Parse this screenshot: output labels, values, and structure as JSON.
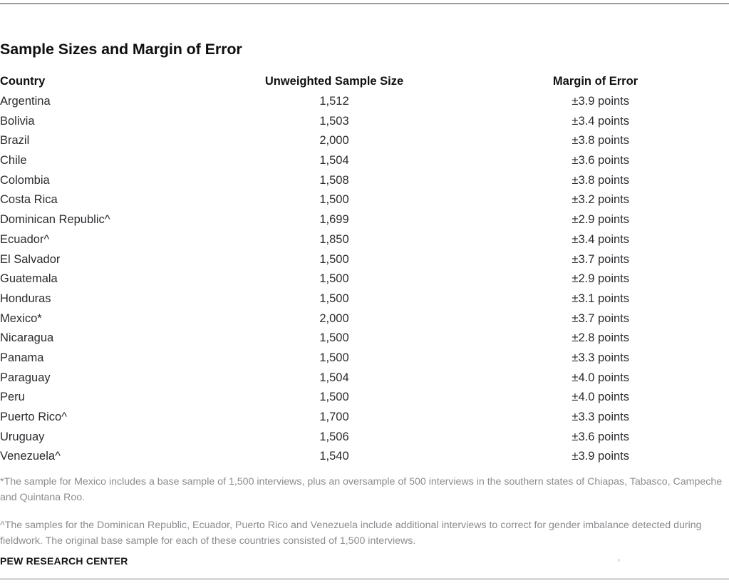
{
  "title": "Sample Sizes and Margin of Error",
  "columns": {
    "country": "Country",
    "sample_size": "Unweighted Sample Size",
    "margin_of_error": "Margin of Error"
  },
  "rows": [
    {
      "country": "Argentina",
      "sample_size": "1,512",
      "margin_of_error": "±3.9 points"
    },
    {
      "country": "Bolivia",
      "sample_size": "1,503",
      "margin_of_error": "±3.4 points"
    },
    {
      "country": "Brazil",
      "sample_size": "2,000",
      "margin_of_error": "±3.8 points"
    },
    {
      "country": "Chile",
      "sample_size": "1,504",
      "margin_of_error": "±3.6 points"
    },
    {
      "country": "Colombia",
      "sample_size": "1,508",
      "margin_of_error": "±3.8 points"
    },
    {
      "country": "Costa Rica",
      "sample_size": "1,500",
      "margin_of_error": "±3.2 points"
    },
    {
      "country": "Dominican Republic^",
      "sample_size": "1,699",
      "margin_of_error": "±2.9 points"
    },
    {
      "country": "Ecuador^",
      "sample_size": "1,850",
      "margin_of_error": "±3.4 points"
    },
    {
      "country": "El Salvador",
      "sample_size": "1,500",
      "margin_of_error": "±3.7 points"
    },
    {
      "country": "Guatemala",
      "sample_size": "1,500",
      "margin_of_error": "±2.9 points"
    },
    {
      "country": "Honduras",
      "sample_size": "1,500",
      "margin_of_error": "±3.1 points"
    },
    {
      "country": "Mexico*",
      "sample_size": "2,000",
      "margin_of_error": "±3.7 points"
    },
    {
      "country": "Nicaragua",
      "sample_size": "1,500",
      "margin_of_error": "±2.8 points"
    },
    {
      "country": "Panama",
      "sample_size": "1,500",
      "margin_of_error": "±3.3 points"
    },
    {
      "country": "Paraguay",
      "sample_size": "1,504",
      "margin_of_error": "±4.0 points"
    },
    {
      "country": "Peru",
      "sample_size": "1,500",
      "margin_of_error": "±4.0 points"
    },
    {
      "country": "Puerto Rico^",
      "sample_size": "1,700",
      "margin_of_error": "±3.3 points"
    },
    {
      "country": "Uruguay",
      "sample_size": "1,506",
      "margin_of_error": "±3.6 points"
    },
    {
      "country": "Venezuela^",
      "sample_size": "1,540",
      "margin_of_error": "±3.9 points"
    }
  ],
  "footnotes": [
    "*The sample for Mexico includes a base sample of 1,500 interviews, plus an oversample of 500 interviews in the southern states of Chiapas, Tabasco, Campeche and Quintana Roo.",
    "^The samples for the Dominican Republic, Ecuador, Puerto Rico and Venezuela include additional interviews to correct for gender imbalance detected during fieldwork. The original base sample for each of these countries consisted of 1,500 interviews."
  ],
  "source": "PEW RESEARCH CENTER",
  "chart_data": {
    "type": "table",
    "title": "Sample Sizes and Margin of Error",
    "columns": [
      "Country",
      "Unweighted Sample Size",
      "Margin of Error"
    ],
    "categories": [
      "Argentina",
      "Bolivia",
      "Brazil",
      "Chile",
      "Colombia",
      "Costa Rica",
      "Dominican Republic^",
      "Ecuador^",
      "El Salvador",
      "Guatemala",
      "Honduras",
      "Mexico*",
      "Nicaragua",
      "Panama",
      "Paraguay",
      "Peru",
      "Puerto Rico^",
      "Uruguay",
      "Venezuela^"
    ],
    "series": [
      {
        "name": "Unweighted Sample Size",
        "values": [
          1512,
          1503,
          2000,
          1504,
          1508,
          1500,
          1699,
          1850,
          1500,
          1500,
          1500,
          2000,
          1500,
          1500,
          1504,
          1500,
          1700,
          1506,
          1540
        ]
      },
      {
        "name": "Margin of Error",
        "values": [
          3.9,
          3.4,
          3.8,
          3.6,
          3.8,
          3.2,
          2.9,
          3.4,
          3.7,
          2.9,
          3.1,
          3.7,
          2.8,
          3.3,
          4.0,
          4.0,
          3.3,
          3.6,
          3.9
        ]
      }
    ],
    "xlabel": "",
    "ylabel": "",
    "grid": false,
    "legend": "none"
  },
  "colors": {
    "title_text": "#0f0f0f",
    "body_text": "#2b2b2f",
    "footnote_text": "#8c8c90",
    "rule_top": "#9a9a9e",
    "rule_bottom": "#d8d9db",
    "background": "#ffffff"
  }
}
